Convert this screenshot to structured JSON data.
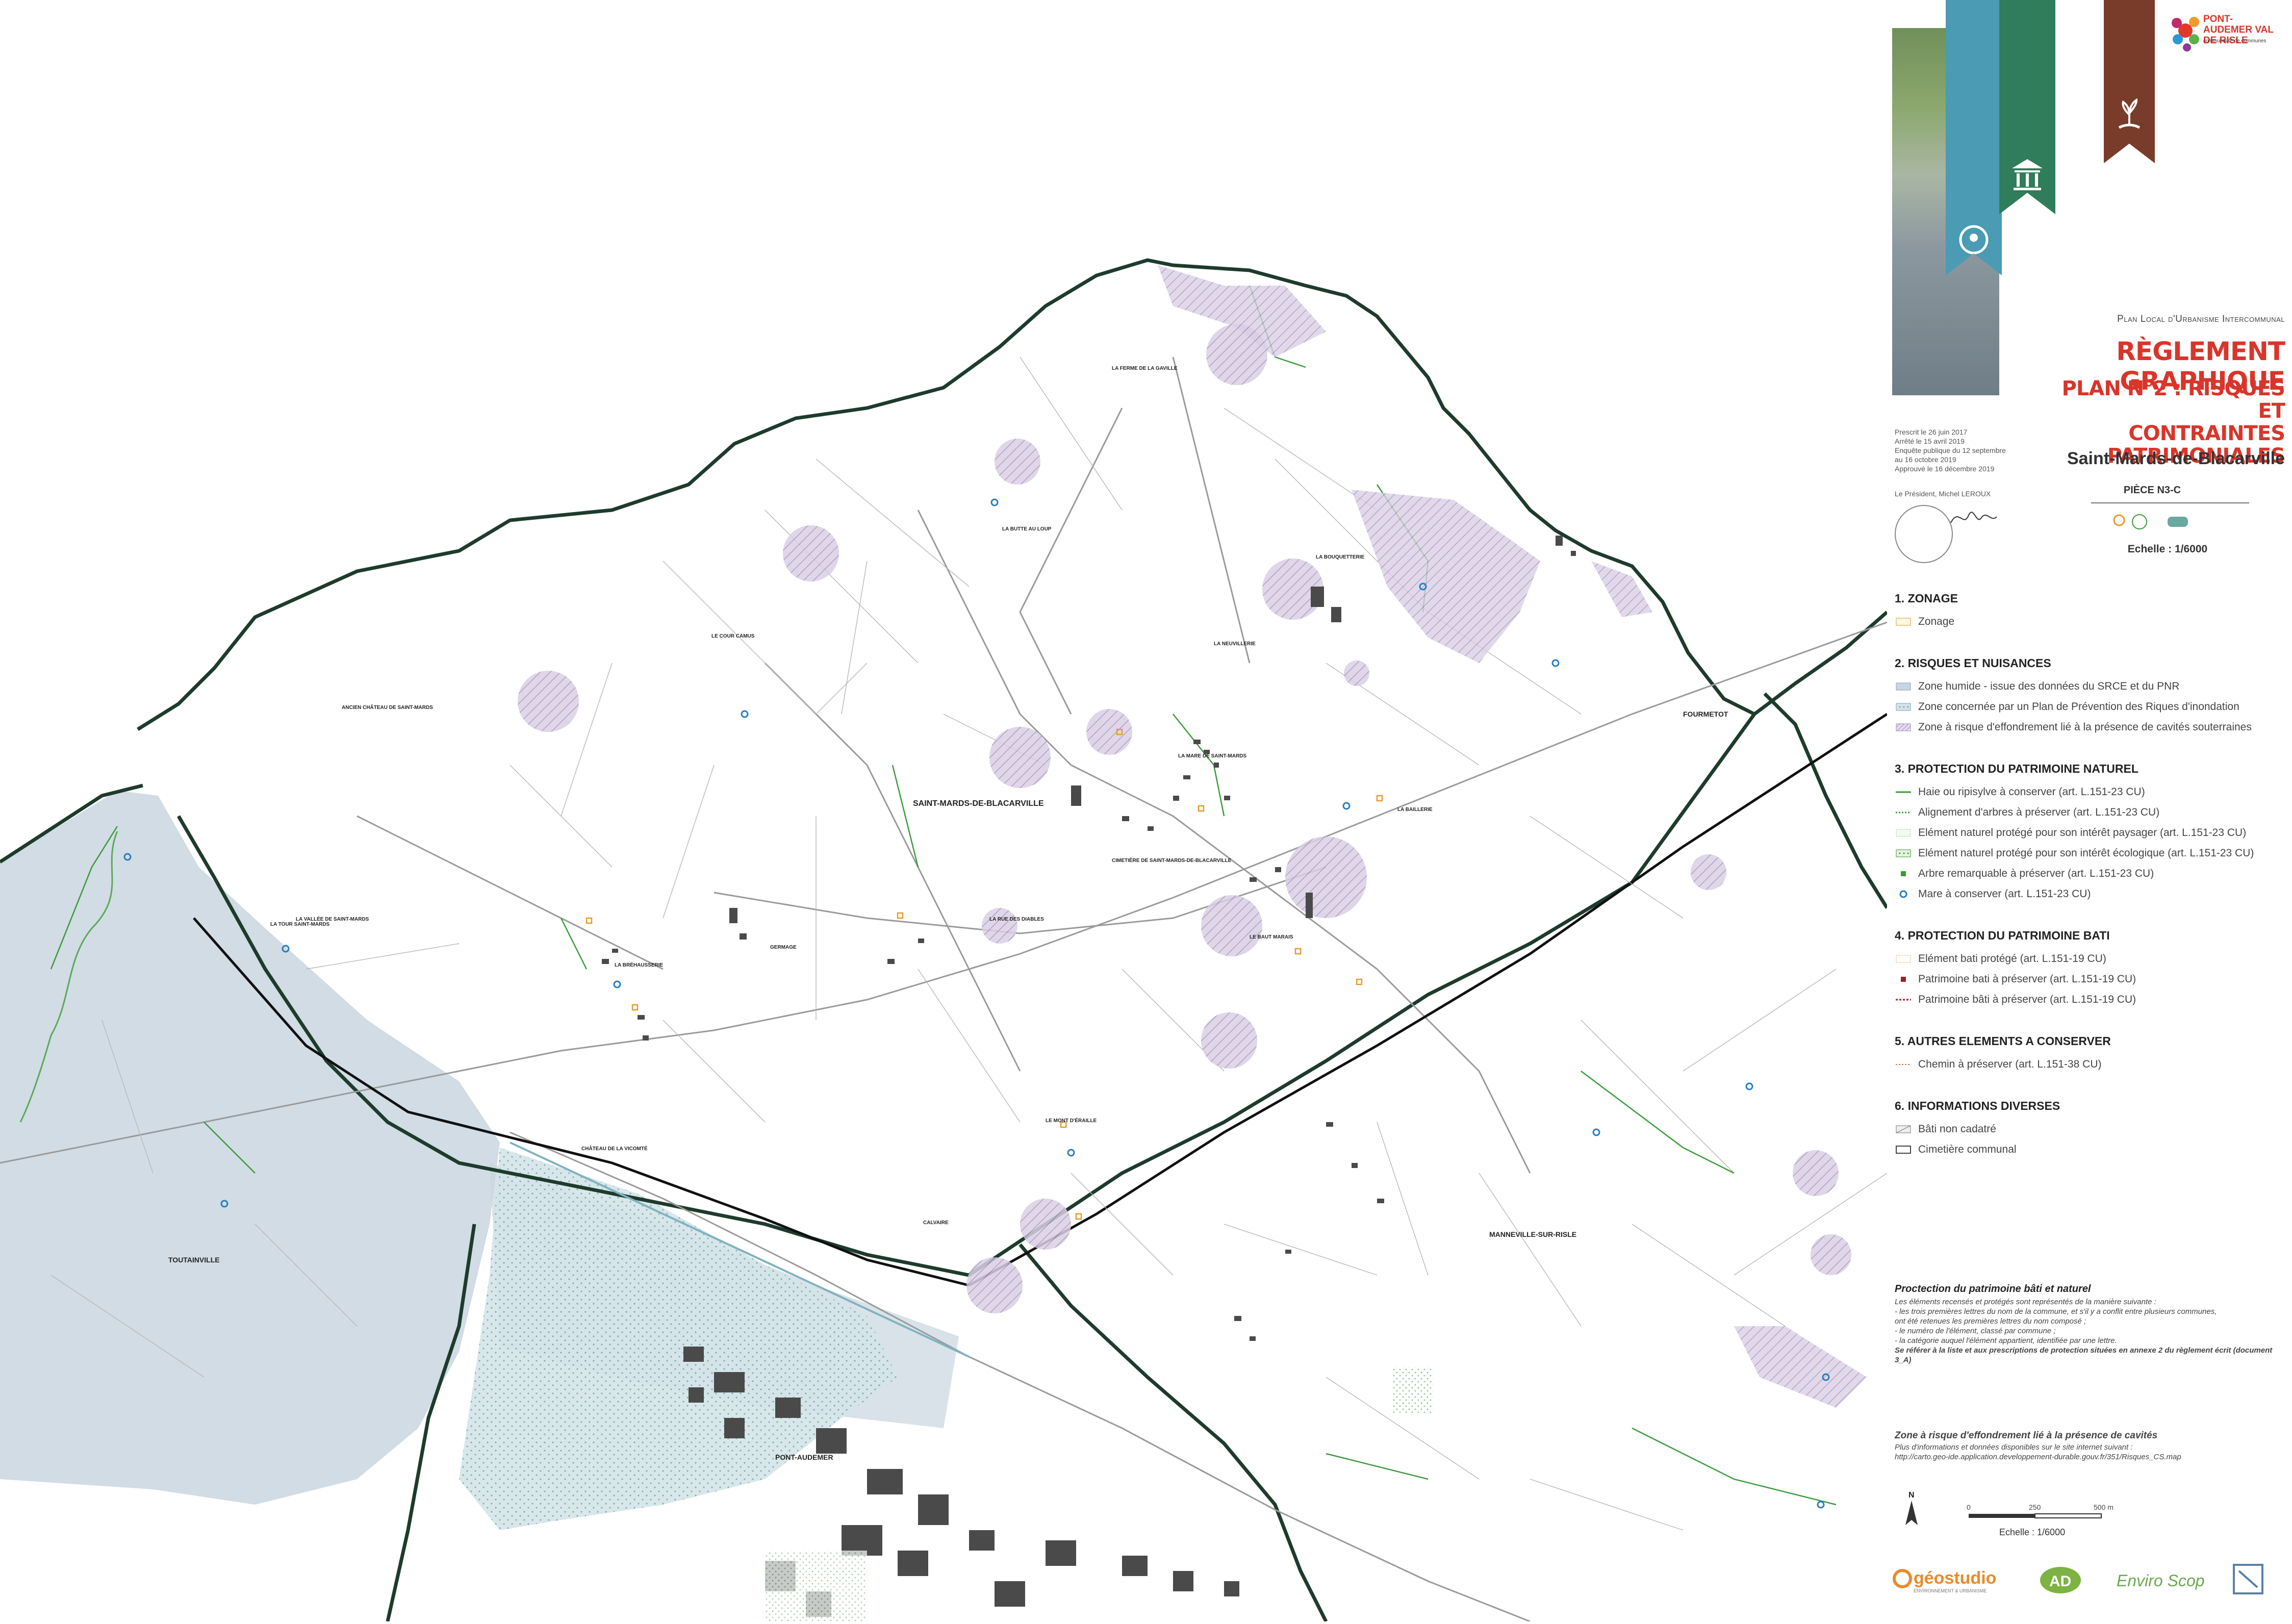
{
  "map": {
    "places": [
      {
        "id": "saint-mards",
        "label": "SAINT-MARDS-DE-BLACARVILLE"
      },
      {
        "id": "pont-audemer",
        "label": "PONT-AUDEMER"
      },
      {
        "id": "toutainville",
        "label": "TOUTAINVILLE"
      },
      {
        "id": "manneville",
        "label": "MANNEVILLE-SUR-RISLE"
      },
      {
        "id": "fourmetot",
        "label": "FOURMETOT"
      },
      {
        "id": "ancien-chateau",
        "label": "ANCIEN CHÂTEAU DE SAINT-MARDS"
      },
      {
        "id": "la-tour",
        "label": "LA TOUR SAINT-MARDS"
      },
      {
        "id": "la-vallee",
        "label": "LA VALLÉE DE SAINT-MARDS"
      },
      {
        "id": "la-ferme",
        "label": "LA FERME DE LA GAVILLE"
      },
      {
        "id": "la-butte",
        "label": "LA BUTTE AU LOUP"
      },
      {
        "id": "la-bouquetterie",
        "label": "LA BOUQUETTERIE"
      },
      {
        "id": "la-neuville",
        "label": "LA NEUVILLERIE"
      },
      {
        "id": "le-cour",
        "label": "LE COUR CAMUS"
      },
      {
        "id": "la-mare",
        "label": "LA MARE DE SAINT-MARDS"
      },
      {
        "id": "la-baillerie",
        "label": "LA BAILLERIE"
      },
      {
        "id": "le-baut",
        "label": "LE BAUT MARAIS"
      },
      {
        "id": "germage",
        "label": "GERMAGE"
      },
      {
        "id": "la-brosse",
        "label": "LA BRÉHAUSSERIE"
      },
      {
        "id": "chateau-vicomte",
        "label": "CHÂTEAU DE LA VICOMTÉ"
      },
      {
        "id": "saint-ouen",
        "label": "LE MONT D'ÉRAILLE"
      },
      {
        "id": "la-rue",
        "label": "LA RUE DES DIABLES"
      },
      {
        "id": "calvaire",
        "label": "CALVAIRE"
      },
      {
        "id": "cimetiere",
        "label": "CIMETIÈRE DE SAINT-MARDS-DE-BLACARVILLE"
      }
    ]
  },
  "title_block": {
    "organization": "PONT-AUDEMER VAL DE RISLE",
    "organization_sub": "communauté de communes",
    "plu_title": "Plan Local d'Urbanisme Intercommunal",
    "main_title": "RÈGLEMENT GRAPHIQUE",
    "plan_title_line1": "PLAN N°2 : RISQUES ET",
    "plan_title_line2": "CONTRAINTES PATRIMONIALES",
    "commune": "Saint-Mards-de-Blacarville",
    "meta": [
      "Prescrit le 26 juin 2017",
      "Arrêté le 15 avril 2019",
      "Enquête publique du 12 septembre",
      "au 16 octobre 2019",
      "Approuvé le 16 décembre 2019"
    ],
    "president": "Le Président, Michel LEROUX",
    "piece": "PIÈCE N3-C",
    "echelle": "Echelle : 1/6000"
  },
  "legend": {
    "sections": [
      {
        "title": "1. ZONAGE",
        "items": [
          {
            "label": "Zonage",
            "sym": "zonage"
          }
        ]
      },
      {
        "title": "2. RISQUES ET NUISANCES",
        "items": [
          {
            "label": "Zone humide - issue des données du SRCE et du PNR",
            "sym": "humide"
          },
          {
            "label": "Zone concernée par un Plan de Prévention des Riques d'inondation",
            "sym": "ppri"
          },
          {
            "label": "Zone à risque d'effondrement lié à la présence de cavités souterraines",
            "sym": "cavite"
          }
        ]
      },
      {
        "title": "3. PROTECTION DU PATRIMOINE NATUREL",
        "items": [
          {
            "label": "Haie ou ripisylve à conserver (art. L.151-23 CU)",
            "sym": "haie"
          },
          {
            "label": "Alignement d'arbres à préserver (art. L.151-23 CU)",
            "sym": "alignement"
          },
          {
            "label": "Elément naturel protégé pour son intérêt paysager (art. L.151-23 CU)",
            "sym": "paysager"
          },
          {
            "label": "Elément naturel protégé pour son intérêt écologique (art. L.151-23 CU)",
            "sym": "ecologique"
          },
          {
            "label": "Arbre remarquable à préserver (art. L.151-23 CU)",
            "sym": "arbre"
          },
          {
            "label": "Mare à conserver (art. L.151-23 CU)",
            "sym": "mare"
          }
        ]
      },
      {
        "title": "4. PROTECTION DU PATRIMOINE BATI",
        "items": [
          {
            "label": "Elément bati protégé (art. L.151-19 CU)",
            "sym": "bati-protege"
          },
          {
            "label": "Patrimoine bati à préserver (art. L.151-19 CU)",
            "sym": "bati-point"
          },
          {
            "label": "Patrimoine bâti à préserver (art. L.151-19 CU)",
            "sym": "bati-ligne"
          }
        ]
      },
      {
        "title": "5. AUTRES ELEMENTS A CONSERVER",
        "items": [
          {
            "label": "Chemin à préserver  (art. L.151-38 CU)",
            "sym": "chemin"
          }
        ]
      },
      {
        "title": "6. INFORMATIONS DIVERSES",
        "items": [
          {
            "label": "Bâti non cadatré",
            "sym": "bati-nc"
          },
          {
            "label": "Cimetière communal",
            "sym": "cimetiere"
          }
        ]
      }
    ]
  },
  "note_patrimoine": {
    "title": "Proctection du patrimoine bâti et naturel",
    "lines": [
      "Les éléments recensés et protégés sont représentés de la manière suivante :",
      "- les trois premières lettres du nom de la commune, et s'il y a conflit entre plusieurs communes,",
      "ont été retenues les premières lettres du nom composé ;",
      "- le numéro de l'élément, classé par commune ;",
      "- la catégorie auquel l'élément appartient, identifiée par une lettre."
    ],
    "bold": "Se référer à la liste et aux prescriptions de protection situées en annexe 2 du règlement écrit (document 3_A)"
  },
  "note_zone": {
    "title": "Zone à risque d'effondrement lié à la présence de cavités",
    "line1": "Plus d'informations et données disponibles sur le site internet suivant :",
    "line2": "http://carto.geo-ide.application.developpement-durable.gouv.fr/351/Risques_CS.map"
  },
  "scale": {
    "north": "N",
    "ticks": [
      "0",
      "250",
      "500 m"
    ],
    "label": "Echelle : 1/6000"
  },
  "footer": {
    "geostudio": "géostudio",
    "geostudio_sub": "ENVIRONNEMENT & URBANISME",
    "ad": "AD",
    "enviroscop": "Enviro Scop"
  },
  "colors": {
    "red": "#d9352a",
    "cavite": "#b7a2c8",
    "humide": "#c9d6e0",
    "green": "#3a9a3a",
    "boundary": "#1e3b2c",
    "building": "#4a4a4a"
  }
}
